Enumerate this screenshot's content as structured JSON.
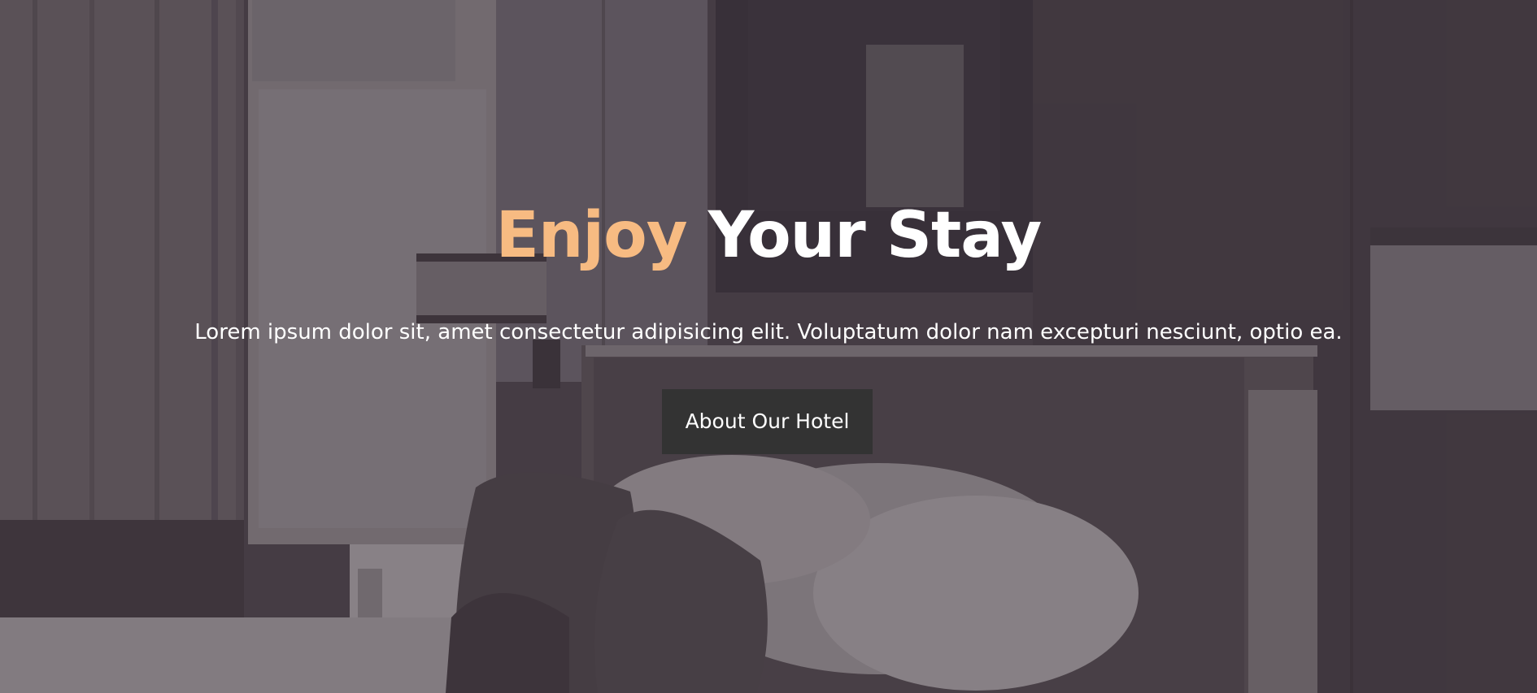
{
  "hero": {
    "title_accent": "Enjoy",
    "title_rest": "Your Stay",
    "subtitle": "Lorem ipsum dolor sit, amet consectetur adipisicing elit. Voluptatum dolor nam excepturi nesciunt, optio ea.",
    "button_label": "About Our Hotel"
  },
  "colors": {
    "accent": "#f7bb82",
    "button_bg": "#333333",
    "text": "#ffffff",
    "overlay": "#4a4249"
  }
}
